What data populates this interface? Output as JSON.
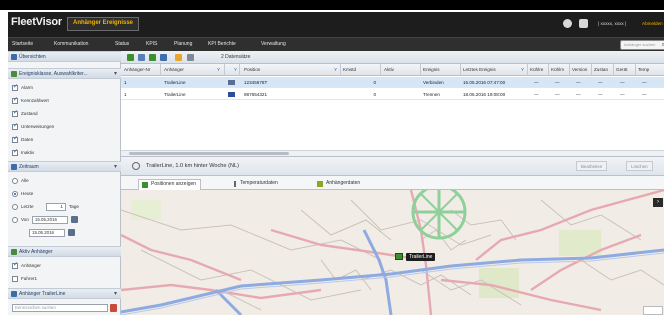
{
  "app": {
    "logo": "FleetVisor",
    "breadcrumb": "Anhänger Ereignisse",
    "user_text": "| xxxxx, xxxx |",
    "logout_label": "Abmelden"
  },
  "menu": {
    "items": [
      "Startseite",
      "Kommunikation",
      "Status",
      "KPIS",
      "Planung",
      "KPI Berichte",
      "Verwaltung"
    ],
    "search_placeholder": "Anhänger suchen"
  },
  "sidebar": {
    "overview_label": "Übersichten",
    "events_panel": {
      "title": "Ereignisklasse, Auswahlkriter...",
      "items": [
        {
          "label": "Alarm",
          "checked": true
        },
        {
          "label": "Kennzahlwert",
          "checked": true
        },
        {
          "label": "Zustand",
          "checked": true
        },
        {
          "label": "Unterweisungen",
          "checked": true
        },
        {
          "label": "Daten",
          "checked": true
        },
        {
          "label": "Inaktiv",
          "checked": true
        }
      ]
    },
    "period_panel": {
      "title": "Zeitraum",
      "alle": "Alle",
      "heute": "Heute",
      "letzte": "Letzte",
      "letzte_value": "1",
      "letzte_unit": "Tage",
      "von": "Von",
      "date_from": "15.05.2016",
      "date_to": "15.05.2016"
    },
    "trailer_panel": {
      "title": "Aktiv Anhänger",
      "items": [
        {
          "label": "Anhänger",
          "checked": true
        },
        {
          "label": "Fahrer1",
          "checked": false
        }
      ]
    },
    "trailer_search": {
      "title": "Anhänger TrailerLine",
      "placeholder": "Kennzeichen suchen"
    }
  },
  "toolbar": {
    "label": "2 Datensätze"
  },
  "grid": {
    "headers": [
      "Anhänger-Nr",
      "Anhänger",
      "",
      "Position",
      "Kmstd",
      "Aktiv",
      "Ereignis",
      "Letztes Ereignis",
      "Kühlre",
      "Kühlm",
      "Version",
      "Zustan",
      "Gerät",
      "Temp"
    ],
    "rows": [
      {
        "nr": "1",
        "name": "TrailerLine",
        "pos": "12345678T",
        "km": "0",
        "event": "Verbinden",
        "last": "15.05.2016 07:47:00",
        "dash": "—"
      },
      {
        "nr": "1",
        "name": "TrailerLine",
        "pos": "987654321",
        "km": "0",
        "event": "Trennen",
        "last": "18.05.2016 19:08:00",
        "dash": "—"
      }
    ]
  },
  "vehicle_bar": {
    "vehicle": "TrailerLine, 1.0 km hinter Woche (NL)",
    "btn_left": "Bearbeiten",
    "btn_right": "Löschen"
  },
  "tabs": [
    "Positionen anzeigen",
    "Temperaturdaten",
    "Anhängerdaten"
  ],
  "map": {
    "marker_label": "TrailerLine"
  },
  "colors": {
    "accent": "#f0b400",
    "topbar": "#1d1d1d",
    "selected_row": "#d7e6f7",
    "map_bg": "#f1ede6"
  }
}
